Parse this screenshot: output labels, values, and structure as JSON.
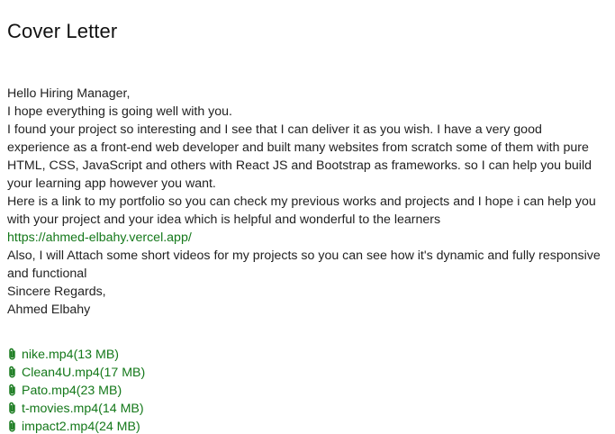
{
  "page": {
    "title": "Cover Letter"
  },
  "letter": {
    "greeting": "Hello Hiring Manager,",
    "line_1": "I hope everything is going well with you.",
    "line_2": "I found your project so interesting and I see that I can deliver it as you wish. I have a very good experience as a front-end web developer and built many websites from scratch some of them with pure HTML, CSS, JavaScript and others with React JS and Bootstrap as frameworks. so I can help you build your learning app however you want.",
    "line_3": "Here is a link to my portfolio so you can check my previous works and projects and I hope i can help you with your project and your idea which is helpful and wonderful to the learners",
    "portfolio_link": "https://ahmed-elbahy.vercel.app/",
    "line_4": "Also, I will Attach some short videos for my projects so you can see how it's dynamic and fully responsive and functional",
    "closing": "Sincere Regards,",
    "signature": "Ahmed Elbahy"
  },
  "attachments": [
    {
      "label": "nike.mp4(13 MB)",
      "icon": "paperclip-icon"
    },
    {
      "label": "Clean4U.mp4(17 MB)",
      "icon": "paperclip-icon"
    },
    {
      "label": "Pato.mp4(23 MB)",
      "icon": "paperclip-icon"
    },
    {
      "label": "t-movies.mp4(14 MB)",
      "icon": "paperclip-icon"
    },
    {
      "label": "impact2.mp4(24 MB)",
      "icon": "paperclip-icon"
    }
  ],
  "colors": {
    "link": "#14781a",
    "text": "#222222",
    "title": "#111111",
    "background": "#ffffff"
  }
}
